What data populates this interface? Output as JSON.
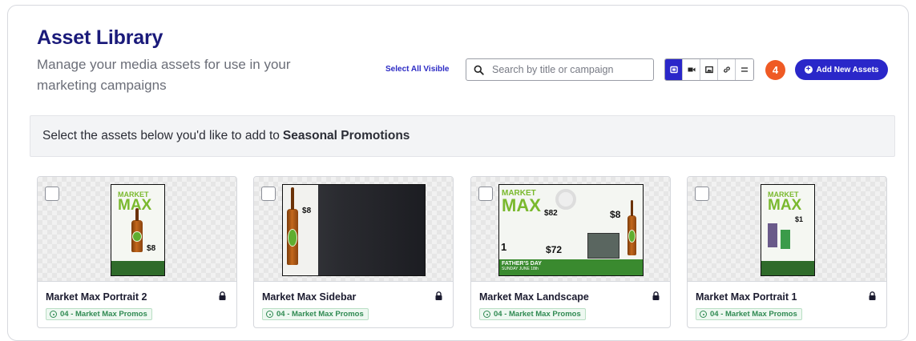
{
  "header": {
    "title": "Asset Library",
    "subtitle": "Manage your media assets for use in your marketing campaigns",
    "select_all_label": "Select All Visible",
    "search_placeholder": "Search by title or campaign",
    "view_toggles": [
      "image-filter-icon",
      "video-filter-icon",
      "photo-filter-icon",
      "link-filter-icon",
      "more-filter-icon"
    ],
    "notification_count": "4",
    "add_button_label": "Add New Assets"
  },
  "banner": {
    "prefix": "Select the assets below you'd like to add to",
    "campaign": "Seasonal Promotions"
  },
  "assets": [
    {
      "name": "Market Max Portrait 2",
      "tag": "04 - Market Max Promos",
      "locked": true
    },
    {
      "name": "Market Max Sidebar",
      "tag": "04 - Market Max Promos",
      "locked": true
    },
    {
      "name": "Market Max Landscape",
      "tag": "04 - Market Max Promos",
      "locked": true
    },
    {
      "name": "Market Max Portrait 1",
      "tag": "04 - Market Max Promos",
      "locked": true
    }
  ],
  "artwork": {
    "logo_line1": "MARKET",
    "logo_line2": "MAX",
    "prices": [
      "8",
      "82",
      "8",
      "72",
      "1",
      "1"
    ],
    "fathers_day": "FATHER'S DAY",
    "fathers_day_date": "SUNDAY JUNE 18th"
  },
  "colors": {
    "brand": "#2a27c9",
    "title": "#1a1a7a",
    "badge": "#ef5a24",
    "tag_green": "#2f8a52"
  }
}
